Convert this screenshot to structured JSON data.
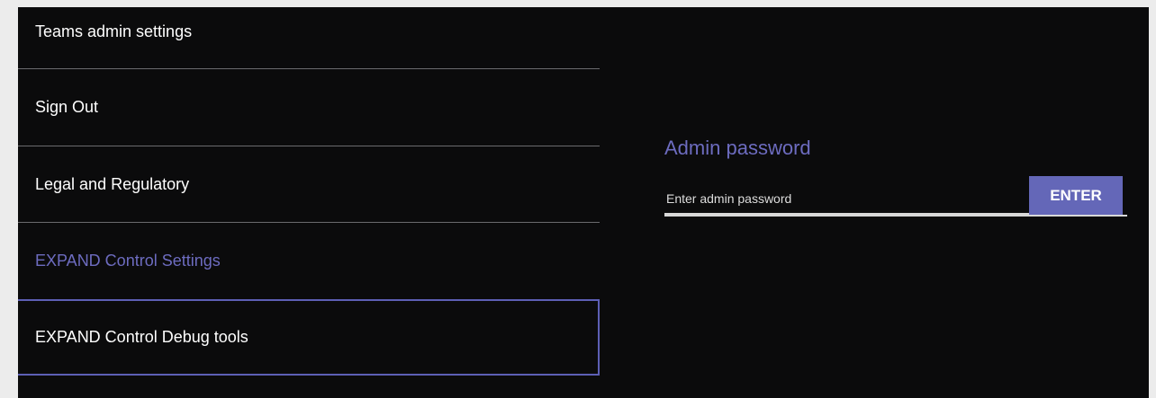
{
  "menu": {
    "items": [
      {
        "label": "Teams admin settings"
      },
      {
        "label": "Sign Out"
      },
      {
        "label": "Legal and Regulatory"
      },
      {
        "label": "EXPAND Control Settings"
      },
      {
        "label": "EXPAND Control Debug tools"
      }
    ]
  },
  "admin_password": {
    "title": "Admin password",
    "placeholder": "Enter admin password",
    "value": "",
    "button_label": "ENTER"
  },
  "colors": {
    "background": "#0b0b0c",
    "accent": "#6d6cc0",
    "button": "#6467b8",
    "focus_border": "#5d5fb5",
    "divider": "#6b6b6e"
  }
}
